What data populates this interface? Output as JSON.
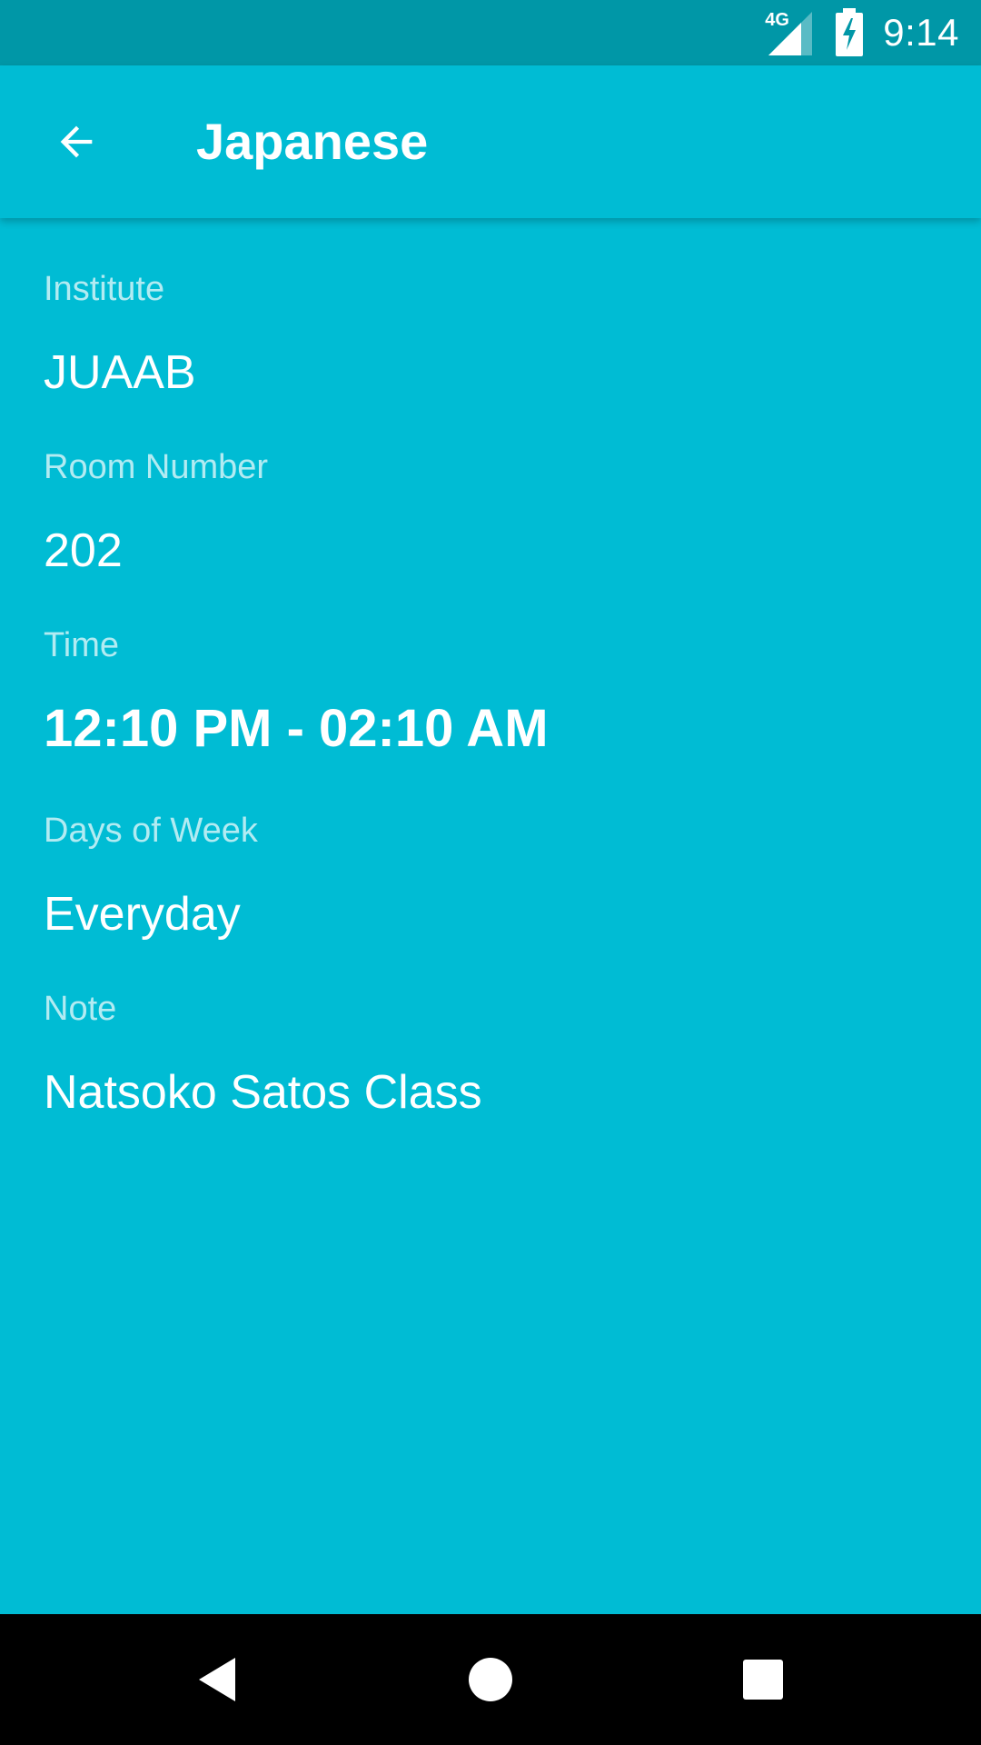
{
  "status_bar": {
    "network": "4G",
    "time": "9:14",
    "icons": [
      "network-4g-icon",
      "signal-icon",
      "battery-charging-icon"
    ]
  },
  "app_bar": {
    "title": "Japanese",
    "back_icon": "arrow-back-icon"
  },
  "details": [
    {
      "label": "Institute",
      "value": "JUAAB"
    },
    {
      "label": "Room Number",
      "value": "202"
    },
    {
      "label": "Time",
      "value": "12:10 PM - 02:10 AM"
    },
    {
      "label": "Days of Week",
      "value": "Everyday"
    },
    {
      "label": "Note",
      "value": "Natsoko Satos Class"
    }
  ],
  "nav_bar": {
    "buttons": [
      "back-triangle-icon",
      "home-circle-icon",
      "recents-square-icon"
    ]
  },
  "colors": {
    "primary": "#00BCD4",
    "primary_dark": "#0097A7",
    "label": "#B2EBF2",
    "text": "#FFFFFF",
    "nav_bar": "#000000"
  }
}
